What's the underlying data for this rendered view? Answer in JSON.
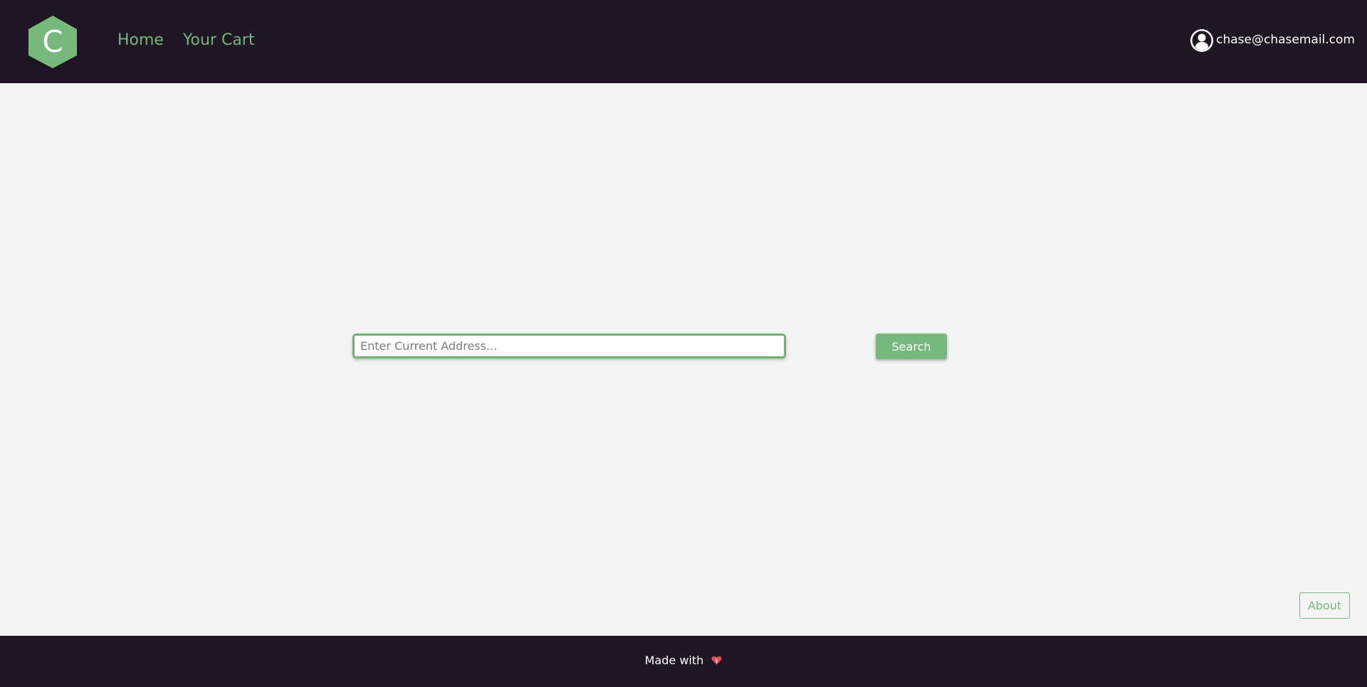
{
  "header": {
    "logo_letter": "C",
    "nav": [
      {
        "label": "Home"
      },
      {
        "label": "Your Cart"
      }
    ],
    "user": {
      "icon": "user-circle-icon",
      "email": "chase@chasemail.com"
    }
  },
  "search": {
    "placeholder": "Enter Current Address...",
    "value": "",
    "button_label": "Search"
  },
  "about_label": "About",
  "footer": {
    "text": "Made with",
    "icon": "heart-icon"
  },
  "colors": {
    "header_bg": "#1f1524",
    "accent": "#77b97d",
    "page_bg": "#f3f5f4",
    "heart": "#e04a52"
  }
}
